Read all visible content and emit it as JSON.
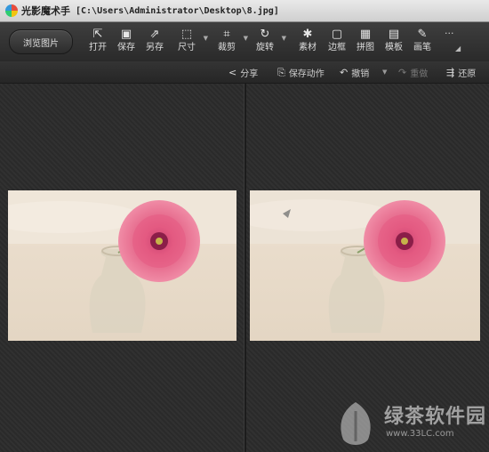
{
  "window": {
    "app_title": "光影魔术手",
    "file_path": "[C:\\Users\\Administrator\\Desktop\\8.jpg]"
  },
  "toolbar": {
    "browse_label": "浏览图片",
    "tools": [
      {
        "label": "打开",
        "icon": "open-icon"
      },
      {
        "label": "保存",
        "icon": "save-icon"
      },
      {
        "label": "另存",
        "icon": "save-as-icon"
      },
      {
        "label": "尺寸",
        "icon": "resize-icon"
      },
      {
        "label": "裁剪",
        "icon": "crop-icon"
      },
      {
        "label": "旋转",
        "icon": "rotate-icon"
      },
      {
        "label": "素材",
        "icon": "material-icon"
      },
      {
        "label": "边框",
        "icon": "border-icon"
      },
      {
        "label": "拼图",
        "icon": "collage-icon"
      },
      {
        "label": "模板",
        "icon": "template-icon"
      },
      {
        "label": "画笔",
        "icon": "brush-icon"
      }
    ],
    "more": "···"
  },
  "subbar": {
    "share": "分享",
    "save_action": "保存动作",
    "undo": "撤销",
    "redo": "重做",
    "restore": "还原"
  },
  "watermark": {
    "brand": "绿茶软件园",
    "url": "www.33LC.com"
  },
  "colors": {
    "background": "#2b2b2b",
    "toolbar": "#333333",
    "flower": "#e4607f"
  }
}
